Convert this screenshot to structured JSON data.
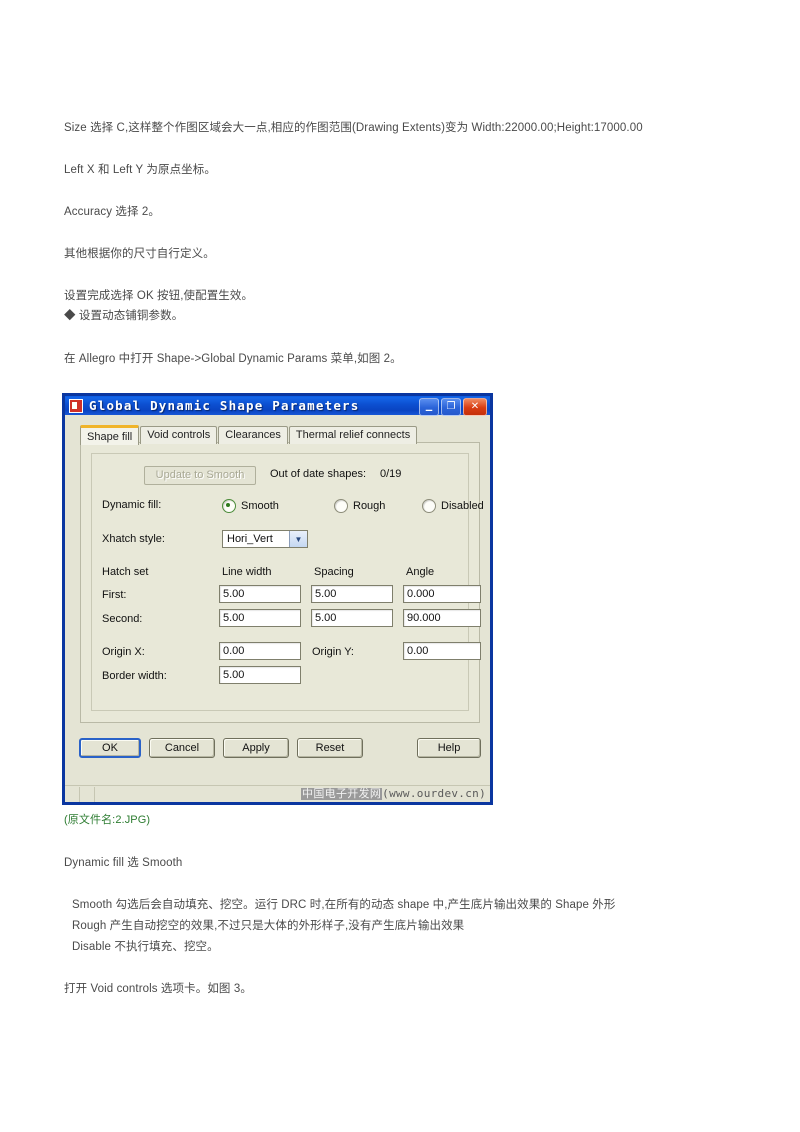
{
  "document": {
    "paragraphs": {
      "size_line": "Size 选择 C,这样整个作图区域会大一点,相应的作图范围(Drawing Extents)变为 Width:22000.00;Height:17000.00",
      "left_xy_line": "Left X 和 Left Y 为原点坐标。",
      "accuracy_line": "Accuracy 选择 2。",
      "other_line": "其他根据你的尺寸自行定义。",
      "ok_line": "设置完成选择 OK 按钮,使配置生效。",
      "bullet_line": "◆ 设置动态铺铜参数。",
      "allegro_line": "在 Allegro 中打开 Shape->Global Dynamic Params 菜单,如图 2。",
      "filename_caption": "(原文件名:2.JPG)",
      "dynamic_fill_line": "Dynamic fill 选 Smooth",
      "smooth_desc": "Smooth 勾选后会自动填充、挖空。运行 DRC 时,在所有的动态 shape 中,产生底片输出效果的 Shape 外形",
      "rough_desc": "Rough 产生自动挖空的效果,不过只是大体的外形样子,没有产生底片输出效果",
      "disable_desc": "Disable 不执行填充、挖空。",
      "void_line": "打开 Void controls 选项卡。如图 3。"
    }
  },
  "dialog": {
    "title": "Global Dynamic Shape Parameters",
    "icon": "app-icon",
    "window_buttons": [
      {
        "name": "minimize",
        "glyph": "_"
      },
      {
        "name": "maximize",
        "glyph": "❐"
      },
      {
        "name": "close",
        "glyph": "✕"
      }
    ],
    "tabs": [
      {
        "label": "Shape fill",
        "active": true
      },
      {
        "label": "Void controls",
        "active": false
      },
      {
        "label": "Clearances",
        "active": false
      },
      {
        "label": "Thermal relief connects",
        "active": false
      }
    ],
    "shape_fill": {
      "update_button": "Update to Smooth",
      "update_button_disabled": true,
      "out_of_date_label": "Out of date shapes:",
      "out_of_date_value": "0/19",
      "dynamic_fill_label": "Dynamic fill:",
      "dynamic_fill_options": [
        {
          "label": "Smooth",
          "selected": true
        },
        {
          "label": "Rough",
          "selected": false
        },
        {
          "label": "Disabled",
          "selected": false
        }
      ],
      "xhatch_style_label": "Xhatch style:",
      "xhatch_style_value": "Hori_Vert",
      "hatch_set_label": "Hatch set",
      "columns": [
        "Line width",
        "Spacing",
        "Angle"
      ],
      "rows": [
        {
          "label": "First:",
          "line_width": "5.00",
          "spacing": "5.00",
          "angle": "0.000"
        },
        {
          "label": "Second:",
          "line_width": "5.00",
          "spacing": "5.00",
          "angle": "90.000"
        }
      ],
      "origin_x_label": "Origin X:",
      "origin_x_value": "0.00",
      "origin_y_label": "Origin Y:",
      "origin_y_value": "0.00",
      "border_width_label": "Border width:",
      "border_width_value": "5.00"
    },
    "buttons": [
      {
        "label": "OK",
        "default": true
      },
      {
        "label": "Cancel",
        "default": false
      },
      {
        "label": "Apply",
        "default": false
      },
      {
        "label": "Reset",
        "default": false
      },
      {
        "label": "Help",
        "default": false
      }
    ],
    "watermark_cn": "中国电子开发网",
    "watermark_url": "(www.ourdev.cn)"
  },
  "colors": {
    "title_bar": "#0c4fd0",
    "dialog_bg": "#e4e4d4",
    "active_tab_accent": "#f0b429",
    "radio_selected": "#2f7a1e",
    "caption_green": "#2e7d32"
  }
}
